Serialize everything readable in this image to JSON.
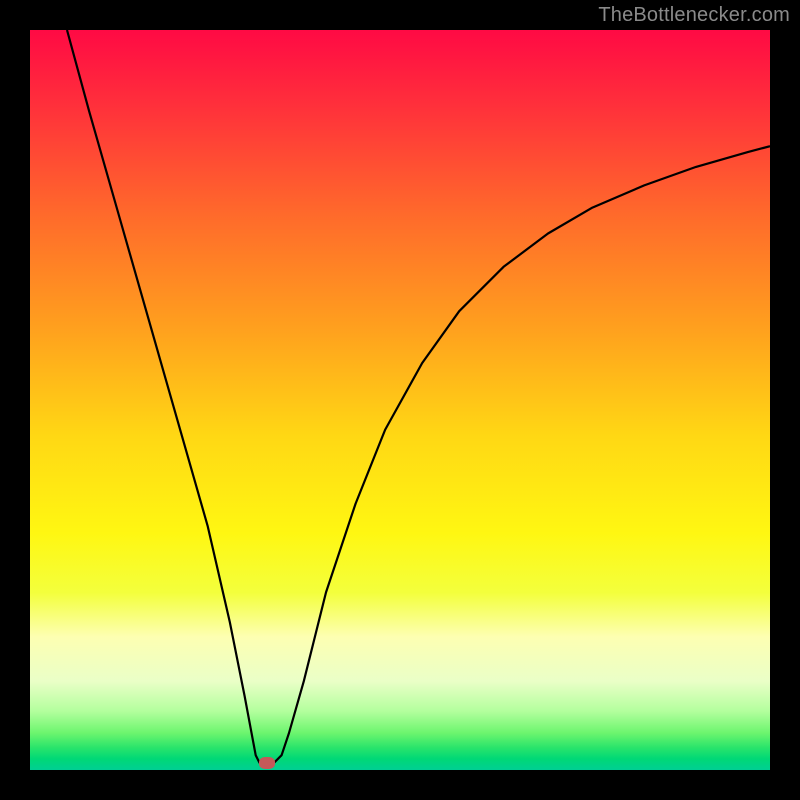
{
  "attribution": "TheBottlenecker.com",
  "chart_data": {
    "type": "line",
    "title": "",
    "xlabel": "",
    "ylabel": "",
    "xlim": [
      0,
      100
    ],
    "ylim": [
      0,
      100
    ],
    "curve": {
      "x": [
        5,
        8,
        12,
        16,
        20,
        24,
        27,
        29,
        30.5,
        31,
        33,
        34,
        35,
        37,
        40,
        44,
        48,
        53,
        58,
        64,
        70,
        76,
        83,
        90,
        97,
        100
      ],
      "y": [
        100,
        89,
        75,
        61,
        47,
        33,
        20,
        10,
        2,
        1,
        1,
        2,
        5,
        12,
        24,
        36,
        46,
        55,
        62,
        68,
        72.5,
        76,
        79,
        81.5,
        83.5,
        84.3
      ]
    },
    "marker": {
      "x": 32,
      "y": 1
    },
    "colors": {
      "curve": "#000000",
      "marker": "#c45959",
      "top": "#ff0a44",
      "bottom": "#00cf94"
    }
  }
}
